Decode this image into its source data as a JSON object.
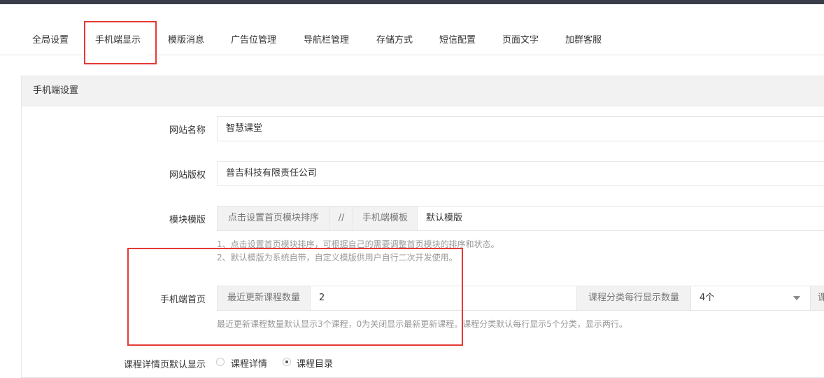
{
  "tabs": [
    {
      "label": "全局设置"
    },
    {
      "label": "手机端显示"
    },
    {
      "label": "模版消息"
    },
    {
      "label": "广告位管理"
    },
    {
      "label": "导航栏管理"
    },
    {
      "label": "存储方式"
    },
    {
      "label": "短信配置"
    },
    {
      "label": "页面文字"
    },
    {
      "label": "加群客服"
    }
  ],
  "panel": {
    "title": "手机端设置"
  },
  "site_name": {
    "label": "网站名称",
    "value": "智慧课堂"
  },
  "site_copyright": {
    "label": "网站版权",
    "value": "普吉科技有限责任公司"
  },
  "module_template": {
    "label": "模块模版",
    "sort_button": "点击设置首页模块排序",
    "separator": "//",
    "template_label": "手机端模板",
    "template_value": "默认模版",
    "hint1": "1、点击设置首页模块排序，可根据自己的需要调整首页模块的排序和状态。",
    "hint2": "2、默认模版为系统自带，自定义模版供用户自行二次开发使用。"
  },
  "mobile_home": {
    "label": "手机端首页",
    "recent_label": "最近更新课程数量",
    "recent_value": "2",
    "category_label": "课程分类每行显示数量",
    "category_value": "4个",
    "next_addon": "课",
    "hint": "最近更新课程数量默认显示3个课程，0为关闭显示最新更新课程。课程分类默认每行显示5个分类，显示两行。"
  },
  "course_detail": {
    "label": "课程详情页默认显示",
    "options": [
      {
        "label": "课程详情",
        "checked": false
      },
      {
        "label": "课程目录",
        "checked": true
      }
    ]
  },
  "colors": {
    "highlight_border": "#e53935",
    "topbar": "#393d49"
  }
}
